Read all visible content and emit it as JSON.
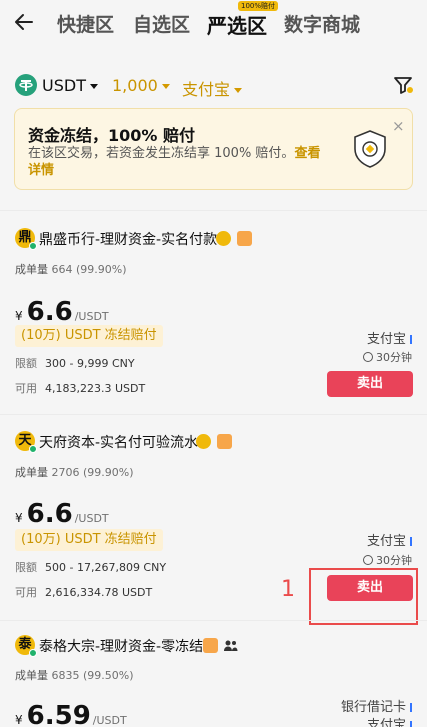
{
  "header": {
    "tabs": [
      {
        "label": "快捷区",
        "active": false
      },
      {
        "label": "自选区",
        "active": false
      },
      {
        "label": "严选区",
        "active": true,
        "badge": "100%赔付"
      },
      {
        "label": "数字商城",
        "active": false
      }
    ]
  },
  "filters": {
    "coin": "USDT",
    "amount": "1,000",
    "payment": "支付宝"
  },
  "banner": {
    "title": "资金冻结，100% 赔付",
    "text": "在该区交易，若资金发生冻结享 100% 赔付。",
    "link": "查看详情",
    "close": "×"
  },
  "ads": [
    {
      "avatar": "鼎",
      "merchant": "鼎盛币行-理财资金-实名付款",
      "stats_label": "成单量",
      "stats_value": "664 (99.90%)",
      "currency_symbol": "¥",
      "price": "6.6",
      "price_unit": "/USDT",
      "tag": "(10万) USDT 冻结赔付",
      "limit_label": "限额",
      "limit_value": "300 - 9,999 CNY",
      "available_label": "可用",
      "available_value": "4,183,223.3 USDT",
      "methods": [
        "支付宝"
      ],
      "time": "30分钟",
      "action": "卖出"
    },
    {
      "avatar": "天",
      "merchant": "天府资本-实名付可验流水",
      "stats_label": "成单量",
      "stats_value": "2706 (99.90%)",
      "currency_symbol": "¥",
      "price": "6.6",
      "price_unit": "/USDT",
      "tag": "(10万) USDT 冻结赔付",
      "limit_label": "限额",
      "limit_value": "500 - 17,267,809 CNY",
      "available_label": "可用",
      "available_value": "2,616,334.78 USDT",
      "methods": [
        "支付宝"
      ],
      "time": "30分钟",
      "action": "卖出"
    },
    {
      "avatar": "泰",
      "merchant": "泰格大宗-理财资金-零冻结",
      "stats_label": "成单量",
      "stats_value": "6835 (99.50%)",
      "currency_symbol": "¥",
      "price": "6.59",
      "price_unit": "/USDT",
      "methods": [
        "银行借记卡",
        "支付宝"
      ]
    }
  ],
  "annotation": {
    "number": "1"
  },
  "colors": {
    "accent": "#f0b90b",
    "sell": "#e94359",
    "annotation": "#ea4b4b"
  }
}
